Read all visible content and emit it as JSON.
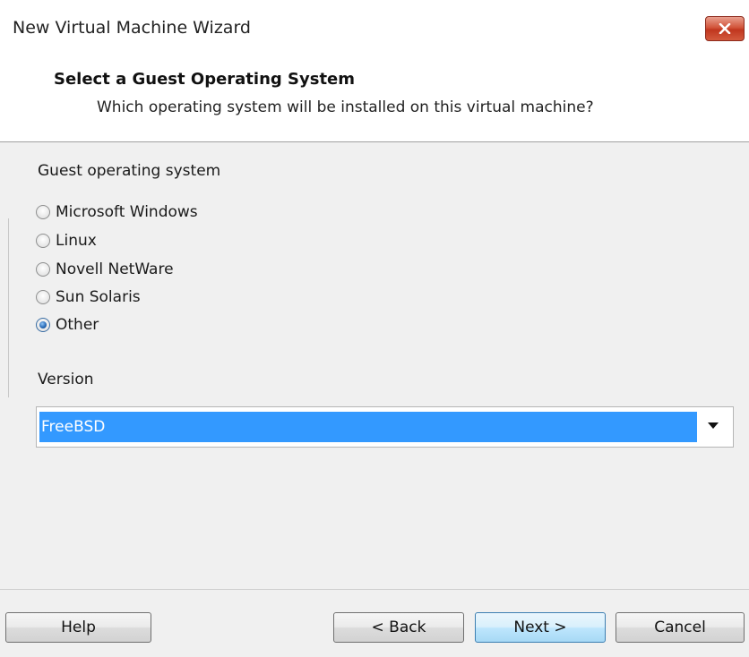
{
  "window": {
    "title": "New Virtual Machine Wizard"
  },
  "header": {
    "title": "Select a Guest Operating System",
    "subtitle": "Which operating system will be installed on this virtual machine?"
  },
  "guest_os": {
    "label": "Guest operating system",
    "options": [
      {
        "label": "Microsoft Windows",
        "checked": false
      },
      {
        "label": "Linux",
        "checked": false
      },
      {
        "label": "Novell NetWare",
        "checked": false
      },
      {
        "label": "Sun Solaris",
        "checked": false
      },
      {
        "label": "Other",
        "checked": true
      }
    ]
  },
  "version": {
    "label": "Version",
    "selected": "FreeBSD"
  },
  "buttons": {
    "help": "Help",
    "back": "< Back",
    "next": "Next >",
    "cancel": "Cancel"
  },
  "colors": {
    "selection": "#3399ff",
    "close_button": "#c0361f",
    "panel_background": "#f0f0f0"
  },
  "icons": {
    "close": "close-icon",
    "dropdown": "chevron-down-icon"
  }
}
